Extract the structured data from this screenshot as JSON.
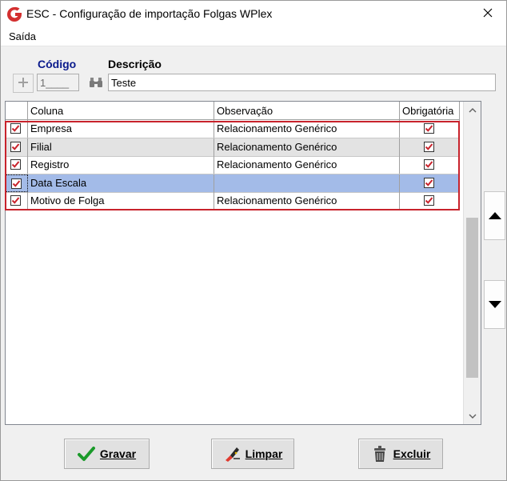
{
  "window": {
    "title": "ESC - Configuração de importação Folgas WPlex"
  },
  "menu": {
    "saida": "Saída"
  },
  "form": {
    "codigo_label": "Código",
    "descricao_label": "Descrição",
    "codigo_value": "1____",
    "descricao_value": "Teste"
  },
  "grid": {
    "columns": [
      "",
      "Coluna",
      "Observação",
      "Obrigatória"
    ],
    "rows": [
      {
        "checked": true,
        "coluna": "Empresa",
        "observacao": "Relacionamento Genérico",
        "obrigatoria": true
      },
      {
        "checked": true,
        "coluna": "Filial",
        "observacao": "Relacionamento Genérico",
        "obrigatoria": true
      },
      {
        "checked": true,
        "coluna": "Registro",
        "observacao": "Relacionamento Genérico",
        "obrigatoria": true
      },
      {
        "checked": true,
        "coluna": "Data Escala",
        "observacao": "",
        "obrigatoria": true,
        "selected": true
      },
      {
        "checked": true,
        "coluna": "Motivo de Folga",
        "observacao": "Relacionamento Genérico",
        "obrigatoria": true
      }
    ]
  },
  "buttons": {
    "gravar": "Gravar",
    "limpar": "Limpar",
    "excluir": "Excluir"
  },
  "icons": {
    "app": "app-logo-icon",
    "close": "close-icon",
    "plus": "plus-icon",
    "search": "binoculars-icon",
    "move_up": "triangle-up-icon",
    "move_down": "triangle-down-icon",
    "gravar": "check-icon",
    "limpar": "eraser-icon",
    "excluir": "trash-icon"
  },
  "colors": {
    "codigo_label": "#0a1a8c",
    "selected_row": "#a3bbe8",
    "alt_row": "#e3e3e3",
    "highlight_border": "#c8232c",
    "checkbox_mark": "#c8232c"
  }
}
